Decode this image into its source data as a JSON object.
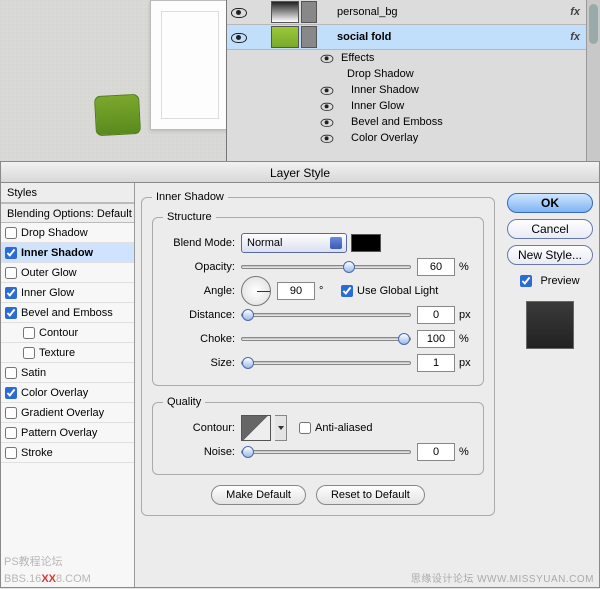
{
  "layers": {
    "personal_bg": "personal_bg",
    "social_fold": "social fold",
    "effects": "Effects",
    "drop_shadow": "Drop Shadow",
    "inner_shadow": "Inner Shadow",
    "inner_glow": "Inner Glow",
    "bevel_emboss": "Bevel and Emboss",
    "color_overlay": "Color Overlay"
  },
  "modal": {
    "title": "Layer Style",
    "styles_header": "Styles",
    "blending_header": "Blending Options: Default",
    "items": {
      "drop_shadow": "Drop Shadow",
      "inner_shadow": "Inner Shadow",
      "outer_glow": "Outer Glow",
      "inner_glow": "Inner Glow",
      "bevel": "Bevel and Emboss",
      "contour": "Contour",
      "texture": "Texture",
      "satin": "Satin",
      "color_overlay": "Color Overlay",
      "gradient_overlay": "Gradient Overlay",
      "pattern_overlay": "Pattern Overlay",
      "stroke": "Stroke"
    },
    "panel_title": "Inner Shadow",
    "structure_legend": "Structure",
    "quality_legend": "Quality",
    "blend_mode_label": "Blend Mode:",
    "blend_mode_value": "Normal",
    "opacity_label": "Opacity:",
    "opacity_value": "60",
    "angle_label": "Angle:",
    "angle_value": "90",
    "use_global": "Use Global Light",
    "distance_label": "Distance:",
    "distance_value": "0",
    "choke_label": "Choke:",
    "choke_value": "100",
    "size_label": "Size:",
    "size_value": "1",
    "contour_label": "Contour:",
    "antialiased": "Anti-aliased",
    "noise_label": "Noise:",
    "noise_value": "0",
    "make_default": "Make Default",
    "reset_default": "Reset to Default",
    "percent": "%",
    "px": "px",
    "deg": "°"
  },
  "buttons": {
    "ok": "OK",
    "cancel": "Cancel",
    "new_style": "New Style...",
    "preview": "Preview"
  },
  "watermarks": {
    "right": "思缘设计论坛  WWW.MISSYUAN.COM",
    "left_a": "PS教程论坛",
    "left_b": "BBS.16",
    "left_c": "XX",
    "left_d": "8.COM"
  }
}
